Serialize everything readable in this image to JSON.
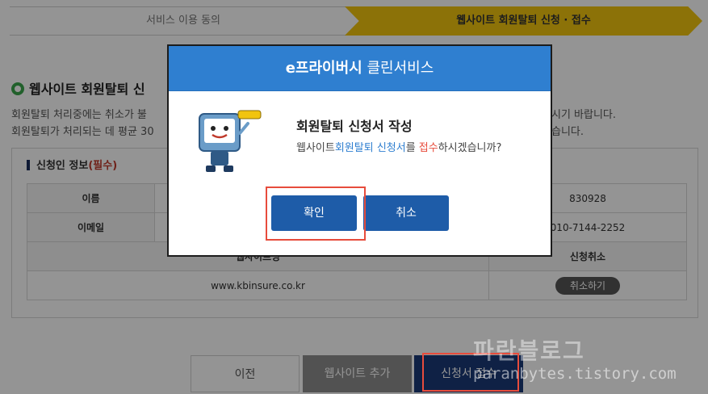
{
  "steps": {
    "step1": "서비스 이용 동의",
    "step2": "웹사이트 회원탈퇴 신청 · 접수"
  },
  "section": {
    "title": "웹사이트 회원탈퇴 신",
    "info_line1_left": "회원탈퇴 처리중에는 취소가 불",
    "info_line1_right": "시기 바랍니다.",
    "info_line2_left": "회원탈퇴가 처리되는 데 평균 30",
    "info_line2_right": "습니다."
  },
  "form": {
    "heading": "신청인 정보",
    "required": "(필수)",
    "rows": [
      {
        "label": "이름",
        "value": "830928"
      },
      {
        "label": "이메일",
        "value": "010-7144-2252"
      }
    ],
    "website_header": "웹사이트명",
    "cancel_header": "신청취소",
    "website_value": "www.kbinsure.co.kr",
    "cancel_button": "취소하기"
  },
  "bottom_buttons": {
    "prev": "이전",
    "add": "웹사이트 추가",
    "submit": "신청서 접수"
  },
  "watermark": {
    "line1": "파란블로그",
    "line2": "paranbytes.tistory.com"
  },
  "modal": {
    "brand": "e프라이버시",
    "service": " 클린서비스",
    "title": "회원탈퇴 신청서 작성",
    "text_before": "웹사이트",
    "text_blue": "회원탈퇴 신청서",
    "text_mid": "를 ",
    "text_red": "접수",
    "text_after": "하시겠습니까?",
    "ok": "확인",
    "cancel": "취소"
  },
  "colors": {
    "modal_header": "#2f7fd0",
    "modal_button": "#1e5ca8",
    "step_active": "#f1c40f",
    "highlight": "#e74c3c"
  }
}
